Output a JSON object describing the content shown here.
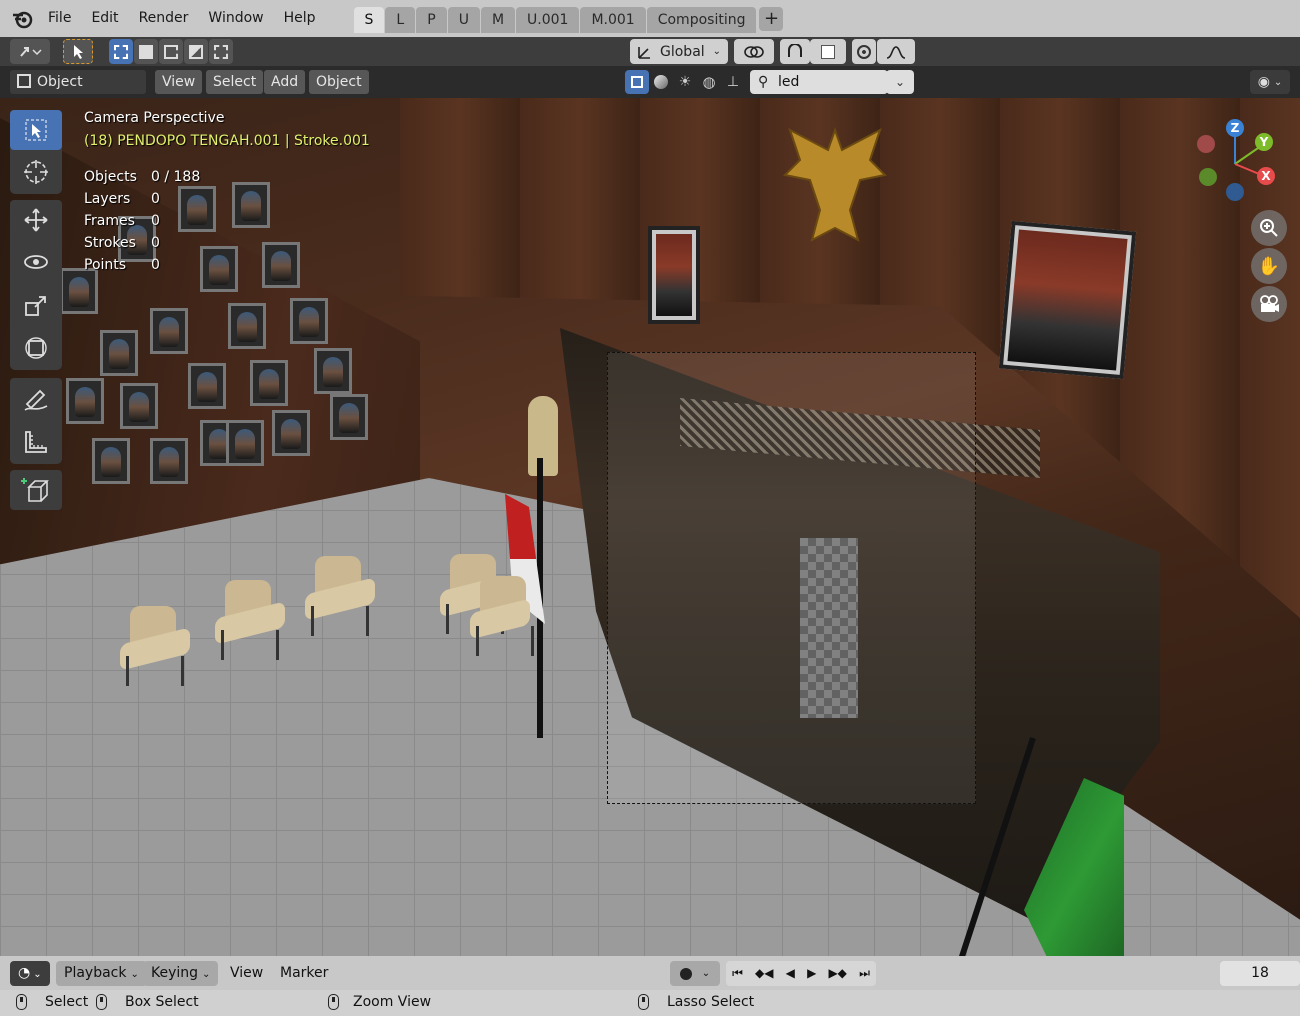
{
  "menu": {
    "items": [
      "File",
      "Edit",
      "Render",
      "Window",
      "Help"
    ]
  },
  "workspaces": {
    "tabs": [
      "S",
      "L",
      "P",
      "U",
      "M",
      "U.001",
      "M.001",
      "Compositing"
    ],
    "active": "S"
  },
  "toolheader": {
    "orientation": "Global"
  },
  "viewheader": {
    "mode": "Object Mode",
    "view": "View",
    "select": "Select",
    "add": "Add",
    "object": "Object",
    "search_value": "led"
  },
  "overlay": {
    "perspective": "Camera Perspective",
    "active_object": "(18) PENDOPO TENGAH.001 | Stroke.001",
    "stats": [
      {
        "label": "Objects",
        "value": "0 / 188"
      },
      {
        "label": "Layers",
        "value": "0"
      },
      {
        "label": "Frames",
        "value": "0"
      },
      {
        "label": "Strokes",
        "value": "0"
      },
      {
        "label": "Points",
        "value": "0"
      }
    ]
  },
  "gizmo": {
    "axes": {
      "z": "Z",
      "y": "Y",
      "x": "X"
    },
    "colors": {
      "x": "#e84b4b",
      "y": "#7dbb2b",
      "z": "#3a82d6"
    }
  },
  "timeline": {
    "playback": "Playback",
    "keying": "Keying",
    "view": "View",
    "marker": "Marker",
    "current_frame": "18"
  },
  "statusbar": {
    "select": "Select",
    "box_select": "Box Select",
    "zoom_view": "Zoom View",
    "lasso_select": "Lasso Select"
  },
  "colors": {
    "accent": "#4772b3",
    "overlay_text_highlight": "#e0f06c"
  }
}
